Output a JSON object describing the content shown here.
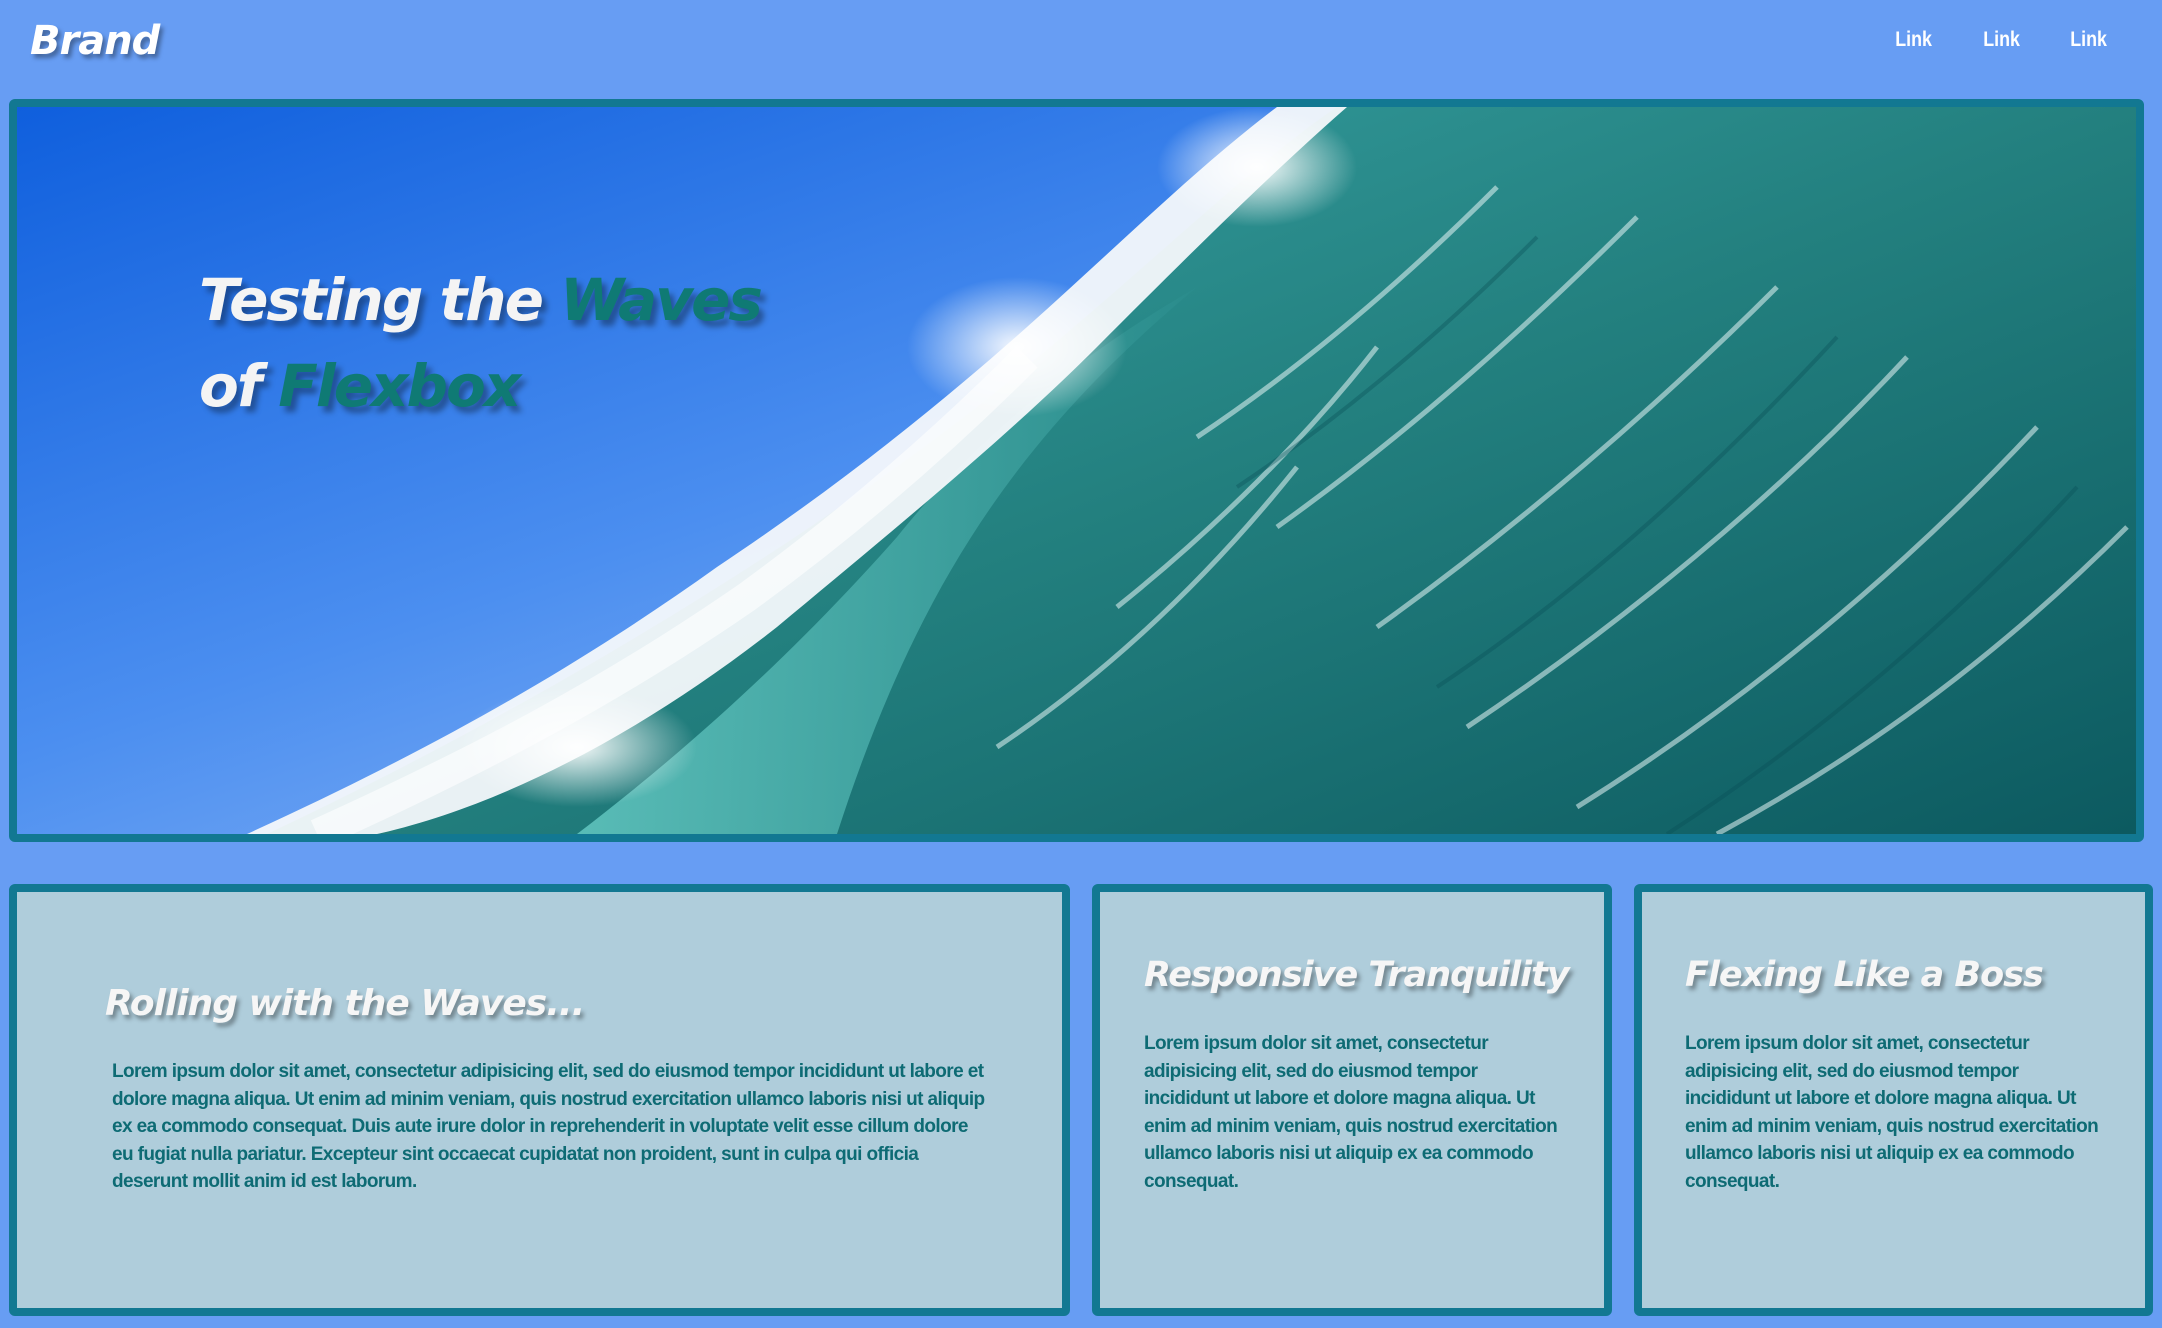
{
  "nav": {
    "brand": "Brand",
    "links": [
      "Link",
      "Link",
      "Link"
    ]
  },
  "hero": {
    "title_part1": "Testing the ",
    "title_accent1": "Waves",
    "title_part2": "of ",
    "title_accent2": "Flexbox",
    "image": "ocean-wave-photo"
  },
  "cards": [
    {
      "title": "Rolling with the Waves...",
      "body": "Lorem ipsum dolor sit amet, consectetur adipisicing elit, sed do eiusmod tempor incididunt ut labore et dolore magna aliqua. Ut enim ad minim veniam, quis nostrud exercitation ullamco laboris nisi ut aliquip ex ea commodo consequat. Duis aute irure dolor in reprehenderit in voluptate velit esse cillum dolore eu fugiat nulla pariatur. Excepteur sint occaecat cupidatat non proident, sunt in culpa qui officia deserunt mollit anim id est laborum."
    },
    {
      "title": "Responsive Tranquility",
      "body": "Lorem ipsum dolor sit amet, consectetur adipisicing elit, sed do eiusmod tempor incididunt ut labore et dolore magna aliqua. Ut enim ad minim veniam, quis nostrud exercitation ullamco laboris nisi ut aliquip ex ea commodo consequat."
    },
    {
      "title": "Flexing Like a Boss",
      "body": "Lorem ipsum dolor sit amet, consectetur adipisicing elit, sed do eiusmod tempor incididunt ut labore et dolore magna aliqua. Ut enim ad minim veniam, quis nostrud exercitation ullamco laboris nisi ut aliquip ex ea commodo consequat."
    }
  ],
  "colors": {
    "page_background": "#679df3",
    "border": "#127892",
    "card_background": "#afcddb",
    "accent_text": "#0f7a74",
    "body_text": "#0e6b74",
    "heading_text": "#f6f6f6"
  }
}
